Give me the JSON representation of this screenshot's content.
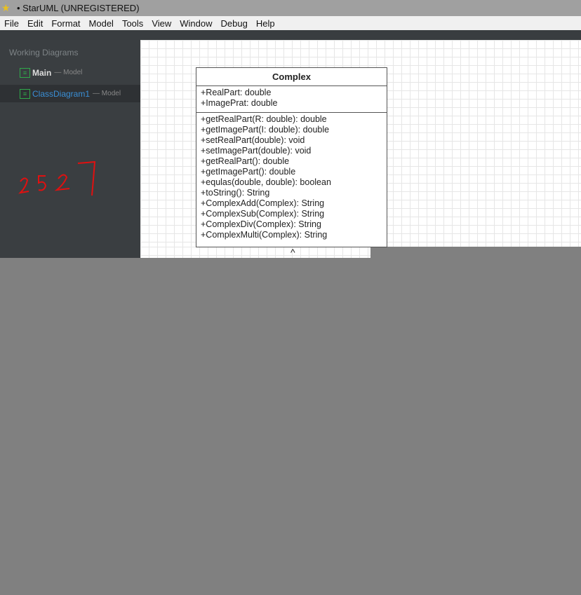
{
  "window": {
    "title": "• StarUML (UNREGISTERED)"
  },
  "menu": [
    "File",
    "Edit",
    "Format",
    "Model",
    "Tools",
    "View",
    "Window",
    "Debug",
    "Help"
  ],
  "sidebar": {
    "header": "Working Diagrams",
    "items": [
      {
        "label": "Main",
        "model": "— Model"
      },
      {
        "label": "ClassDiagram1",
        "model": "— Model",
        "selected": true
      }
    ],
    "handwriting": "2527"
  },
  "class": {
    "name": "Complex",
    "attributes": [
      "+RealPart: double",
      "+ImagePrat: double"
    ],
    "operations": [
      "+getRealPart(R: double): double",
      "+getImagePart(I: double): double",
      "+setRealPart(double): void",
      "+setImagePart(double): void",
      "+getRealPart(): double",
      "+getImagePart(): double",
      "+equlas(double, double): boolean",
      "+toString(): String",
      "+ComplexAdd(Complex): String",
      "+ComplexSub(Complex): String",
      "+ComplexDiv(Complex): String",
      "+ComplexMulti(Complex): String"
    ]
  }
}
